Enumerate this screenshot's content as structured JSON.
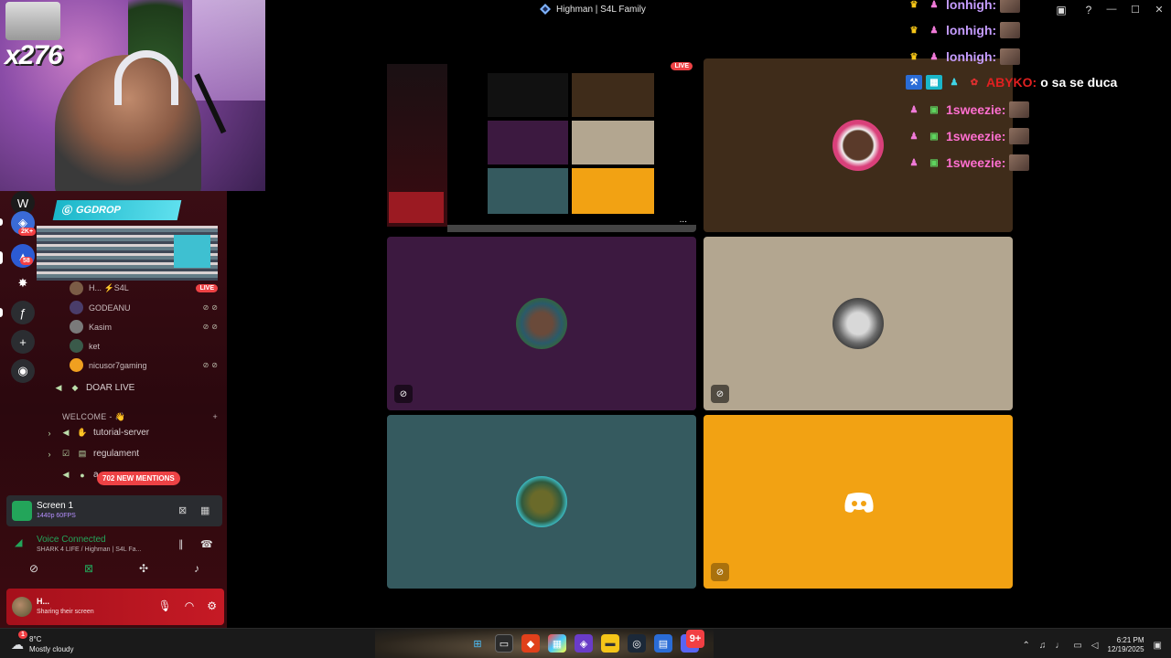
{
  "window": {
    "title": "Highman | S4L Family",
    "controls": [
      "minimize",
      "maximize",
      "close"
    ]
  },
  "webcam": {
    "counter": "x276"
  },
  "sidebar": {
    "servers": [
      {
        "name": "server-a",
        "badge": "2K+",
        "color": "#3a6bd6"
      },
      {
        "name": "server-b",
        "badge": "58",
        "color": "#2c5bd3"
      },
      {
        "name": "server-c",
        "badge": "",
        "color": "#bb5f2a"
      },
      {
        "name": "server-d",
        "badge": "",
        "color": "#2b2d31"
      }
    ],
    "promo": {
      "label": "GGDROP"
    },
    "voice_members": [
      {
        "name": "H... ⚡S4L",
        "live": "LIVE",
        "avatar_color": "#7b5c46"
      },
      {
        "name": "GODEANU",
        "live": "",
        "avatar_color": "#4a3d6a"
      },
      {
        "name": "Kasim",
        "live": "",
        "avatar_color": "#7a7a7a"
      },
      {
        "name": "ket",
        "live": "",
        "avatar_color": "#3a5a4a"
      },
      {
        "name": "nicusor7gaming",
        "live": "",
        "avatar_color": "#f0a020"
      }
    ],
    "channels": {
      "doar_live": "DOAR LIVE",
      "category": "WELCOME - 👋",
      "tutorial": "tutorial-server",
      "regulament": "regulament",
      "third": "a"
    },
    "mentions": "702 NEW MENTIONS",
    "screen_panel": {
      "title": "Screen 1",
      "quality": "1440p 60FPS"
    },
    "voice": {
      "status": "Voice Connected",
      "location": "SHARK 4 LIFE / Highman | S4L Fa..."
    },
    "user": {
      "name": "H...",
      "status": "Sharing their screen"
    }
  },
  "stage": {
    "stream_badge": "LIVE",
    "stream_more": "...",
    "tiles": [
      {
        "name": "brown-tile",
        "color": "#3f2c1a"
      },
      {
        "name": "purple-tile",
        "color": "#3c1940"
      },
      {
        "name": "beige-tile",
        "color": "#b3a690"
      },
      {
        "name": "teal-tile",
        "color": "#355a5f"
      },
      {
        "name": "orange-tile",
        "color": "#f2a213"
      }
    ]
  },
  "chat": [
    {
      "user": "lonhigh:",
      "user_color": "#c59cff",
      "message": ""
    },
    {
      "user": "lonhigh:",
      "user_color": "#c59cff",
      "message": ""
    },
    {
      "user": "lonhigh:",
      "user_color": "#c59cff",
      "message": ""
    },
    {
      "user": "ABYKO:",
      "user_color": "#e02020",
      "message": "o sa se duca"
    },
    {
      "user": "1sweezie:",
      "user_color": "#ff6fd0",
      "message": ""
    },
    {
      "user": "1sweezie:",
      "user_color": "#ff6fd0",
      "message": ""
    },
    {
      "user": "1sweezie:",
      "user_color": "#ff6fd0",
      "message": ""
    }
  ],
  "taskbar": {
    "weather_temp": "8°C",
    "weather_desc": "Mostly cloudy",
    "time": "6:21 PM",
    "date": "12/19/2025",
    "notification_badge": "1",
    "discord_badge": "9+"
  }
}
